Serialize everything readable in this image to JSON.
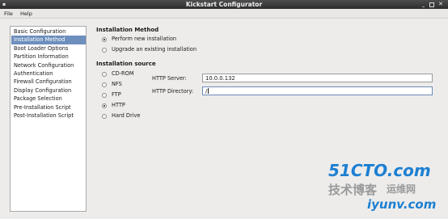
{
  "window": {
    "title": "Kickstart Configurator",
    "menu_icon": "window-menu-icon",
    "minimize_glyph": "_",
    "close_glyph": "✕"
  },
  "menubar": {
    "items": [
      {
        "label": "File"
      },
      {
        "label": "Help"
      }
    ]
  },
  "sidebar": {
    "selected_index": 1,
    "items": [
      {
        "label": "Basic Configuration"
      },
      {
        "label": "Installation Method"
      },
      {
        "label": "Boot Loader Options"
      },
      {
        "label": "Partition Information"
      },
      {
        "label": "Network Configuration"
      },
      {
        "label": "Authentication"
      },
      {
        "label": "Firewall Configuration"
      },
      {
        "label": "Display Configuration"
      },
      {
        "label": "Package Selection"
      },
      {
        "label": "Pre-Installation Script"
      },
      {
        "label": "Post-Installation Script"
      }
    ]
  },
  "installation_method": {
    "title": "Installation Method",
    "options": [
      {
        "label": "Perform new installation",
        "checked": true
      },
      {
        "label": "Upgrade an existing installation",
        "checked": false
      }
    ]
  },
  "installation_source": {
    "title": "Installation source",
    "options": [
      {
        "label": "CD-ROM",
        "checked": false
      },
      {
        "label": "NFS",
        "checked": false
      },
      {
        "label": "FTP",
        "checked": false
      },
      {
        "label": "HTTP",
        "checked": true
      },
      {
        "label": "Hard Drive",
        "checked": false
      }
    ],
    "http_server_label": "HTTP Server:",
    "http_server_value": "10.0.0.132",
    "http_directory_label": "HTTP Directory:",
    "http_directory_value": "/"
  },
  "watermark": {
    "line1": "51CTO.com",
    "line2": "技术博客",
    "line3": "运维网",
    "line4": "iyunv.com"
  },
  "colors": {
    "selection": "#6d8fbd",
    "watermark_blue": "#1c7fd1",
    "watermark_gray": "#9a9a9a"
  }
}
